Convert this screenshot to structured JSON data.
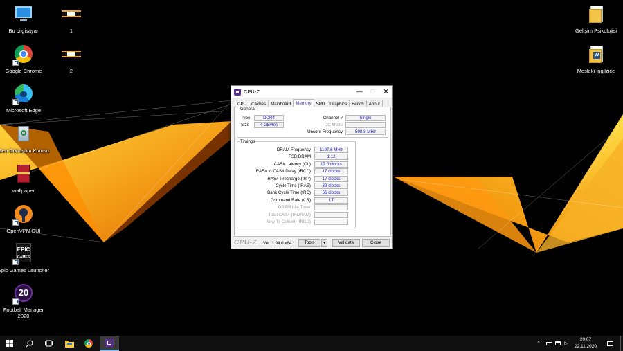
{
  "desktop": {
    "icons": [
      {
        "label": "Bu bilgisayar",
        "icon": "computer-icon"
      },
      {
        "label": "1",
        "icon": "image-file-icon"
      },
      {
        "label": "Google Chrome",
        "icon": "chrome-icon"
      },
      {
        "label": "2",
        "icon": "image-file-icon"
      },
      {
        "label": "Microsoft Edge",
        "icon": "edge-icon"
      },
      {
        "label": "Geri Dönüşüm Kutusu",
        "icon": "recycle-bin-icon"
      },
      {
        "label": "wallpaper",
        "icon": "winrar-icon"
      },
      {
        "label": "OpenVPN GUI",
        "icon": "openvpn-icon"
      },
      {
        "label": "Epic Games Launcher",
        "icon": "epic-games-icon"
      },
      {
        "label": "Football Manager 2020",
        "icon": "football-manager-icon"
      },
      {
        "label": "Gelişim Psikolojisi",
        "icon": "folder-icon"
      },
      {
        "label": "Mesleki İngilzice",
        "icon": "word-document-icon"
      }
    ]
  },
  "cpuz": {
    "title": "CPU-Z",
    "tabs": [
      "CPU",
      "Caches",
      "Mainboard",
      "Memory",
      "SPD",
      "Graphics",
      "Bench",
      "About"
    ],
    "active_tab": "Memory",
    "general": {
      "legend": "General",
      "type_label": "Type",
      "type_value": "DDR4",
      "size_label": "Size",
      "size_value": "4 GBytes",
      "channel_label": "Channel #",
      "channel_value": "Single",
      "dc_mode_label": "DC Mode",
      "dc_mode_value": "",
      "uncore_label": "Uncore Frequency",
      "uncore_value": "598.8 MHz"
    },
    "timings": {
      "legend": "Timings",
      "rows": [
        {
          "label": "DRAM Frequency",
          "value": "1197.6 MHz",
          "enabled": true
        },
        {
          "label": "FSB:DRAM",
          "value": "1:12",
          "enabled": true
        },
        {
          "label": "CAS# Latency (CL)",
          "value": "17.0 clocks",
          "enabled": true
        },
        {
          "label": "RAS# to CAS# Delay (tRCD)",
          "value": "17 clocks",
          "enabled": true
        },
        {
          "label": "RAS# Precharge (tRP)",
          "value": "17 clocks",
          "enabled": true
        },
        {
          "label": "Cycle Time (tRAS)",
          "value": "39 clocks",
          "enabled": true
        },
        {
          "label": "Bank Cycle Time (tRC)",
          "value": "56 clocks",
          "enabled": true
        },
        {
          "label": "Command Rate (CR)",
          "value": "1T",
          "enabled": true
        },
        {
          "label": "DRAM Idle Timer",
          "value": "",
          "enabled": false
        },
        {
          "label": "Total CAS# (tRDRAM)",
          "value": "",
          "enabled": false
        },
        {
          "label": "Row To Column (tRCD)",
          "value": "",
          "enabled": false
        }
      ]
    },
    "footer": {
      "brand": "CPU-Z",
      "version": "Ver. 1.94.0.x64",
      "tools_label": "Tools",
      "validate_label": "Validate",
      "close_label": "Close"
    }
  },
  "taskbar": {
    "items": [
      "start-icon",
      "search-icon",
      "task-view-icon",
      "file-explorer-icon",
      "chrome-icon",
      "cpuz-icon"
    ],
    "clock_time": "20:07",
    "clock_date": "22.11.2020"
  },
  "colors": {
    "wallpaper_orange": "#f5a31a",
    "wallpaper_deep": "#e06a00",
    "value_text": "#1c1cb0",
    "tab_active_text": "#3a3ab8"
  }
}
